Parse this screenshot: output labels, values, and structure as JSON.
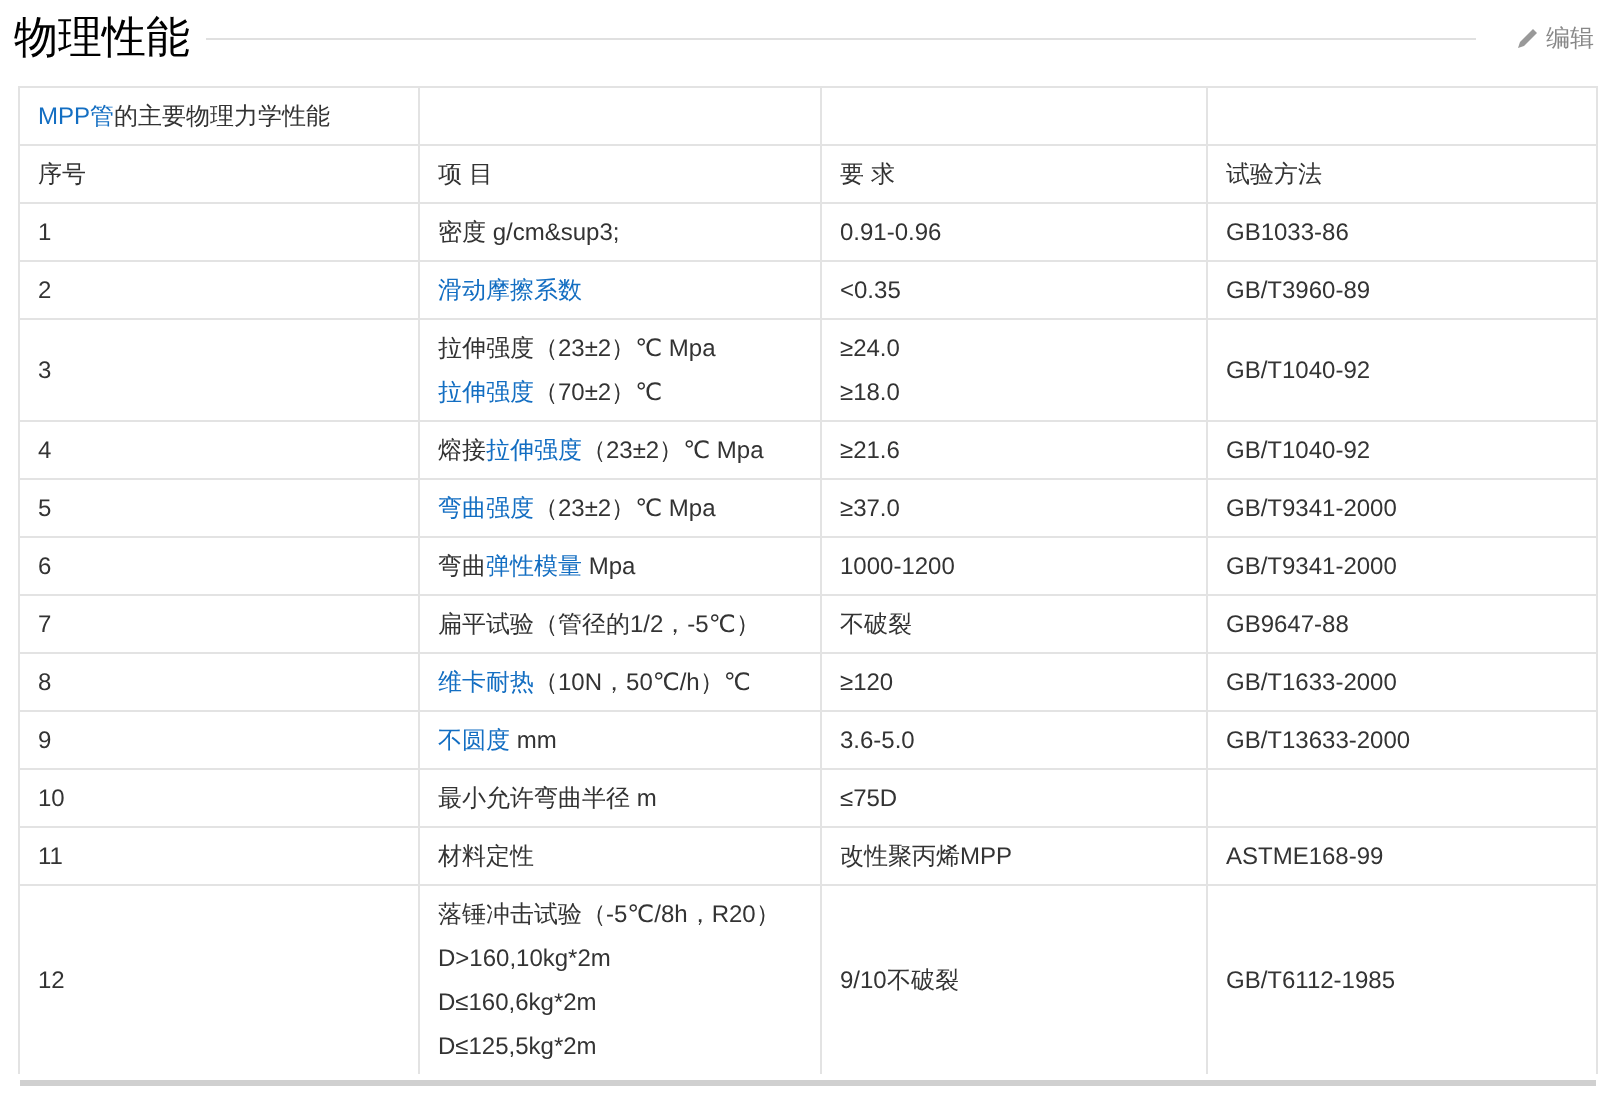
{
  "section": {
    "title": "物理性能",
    "edit_label": "编辑"
  },
  "table": {
    "rows": [
      {
        "cells": [
          [
            [
              {
                "text": "MPP管",
                "link": true
              },
              {
                "text": "的主要物理力学性能",
                "link": false
              }
            ]
          ],
          [],
          [],
          []
        ]
      },
      {
        "cells": [
          [
            [
              {
                "text": "序号",
                "link": false
              }
            ]
          ],
          [
            [
              {
                "text": "项 目",
                "link": false
              }
            ]
          ],
          [
            [
              {
                "text": "要 求",
                "link": false
              }
            ]
          ],
          [
            [
              {
                "text": "试验方法",
                "link": false
              }
            ]
          ]
        ]
      },
      {
        "cells": [
          [
            [
              {
                "text": "1",
                "link": false
              }
            ]
          ],
          [
            [
              {
                "text": "密度 g/cm&sup3;",
                "link": false
              }
            ]
          ],
          [
            [
              {
                "text": "0.91-0.96",
                "link": false
              }
            ]
          ],
          [
            [
              {
                "text": "GB1033-86",
                "link": false
              }
            ]
          ]
        ]
      },
      {
        "cells": [
          [
            [
              {
                "text": "2",
                "link": false
              }
            ]
          ],
          [
            [
              {
                "text": "滑动摩擦系数",
                "link": true
              }
            ]
          ],
          [
            [
              {
                "text": "<0.35",
                "link": false
              }
            ]
          ],
          [
            [
              {
                "text": "GB/T3960-89",
                "link": false
              }
            ]
          ]
        ]
      },
      {
        "cells": [
          [
            [
              {
                "text": "3",
                "link": false
              }
            ]
          ],
          [
            [
              {
                "text": "拉伸强度（23±2）℃ Mpa",
                "link": false
              }
            ],
            [
              {
                "text": "拉伸强度",
                "link": true
              },
              {
                "text": "（70±2）℃",
                "link": false
              }
            ]
          ],
          [
            [
              {
                "text": "≥24.0",
                "link": false
              }
            ],
            [
              {
                "text": "≥18.0",
                "link": false
              }
            ]
          ],
          [
            [
              {
                "text": "GB/T1040-92",
                "link": false
              }
            ]
          ]
        ]
      },
      {
        "cells": [
          [
            [
              {
                "text": "4",
                "link": false
              }
            ]
          ],
          [
            [
              {
                "text": "熔接",
                "link": false
              },
              {
                "text": "拉伸强度",
                "link": true
              },
              {
                "text": "（23±2）℃ Mpa",
                "link": false
              }
            ]
          ],
          [
            [
              {
                "text": "≥21.6",
                "link": false
              }
            ]
          ],
          [
            [
              {
                "text": "GB/T1040-92",
                "link": false
              }
            ]
          ]
        ]
      },
      {
        "cells": [
          [
            [
              {
                "text": "5",
                "link": false
              }
            ]
          ],
          [
            [
              {
                "text": "弯曲强度",
                "link": true
              },
              {
                "text": "（23±2）℃ Mpa",
                "link": false
              }
            ]
          ],
          [
            [
              {
                "text": "≥37.0",
                "link": false
              }
            ]
          ],
          [
            [
              {
                "text": "GB/T9341-2000",
                "link": false
              }
            ]
          ]
        ]
      },
      {
        "cells": [
          [
            [
              {
                "text": "6",
                "link": false
              }
            ]
          ],
          [
            [
              {
                "text": "弯曲",
                "link": false
              },
              {
                "text": "弹性模量",
                "link": true
              },
              {
                "text": " Mpa",
                "link": false
              }
            ]
          ],
          [
            [
              {
                "text": "1000-1200",
                "link": false
              }
            ]
          ],
          [
            [
              {
                "text": "GB/T9341-2000",
                "link": false
              }
            ]
          ]
        ]
      },
      {
        "cells": [
          [
            [
              {
                "text": "7",
                "link": false
              }
            ]
          ],
          [
            [
              {
                "text": "扁平试验（管径的1/2，-5℃）",
                "link": false
              }
            ]
          ],
          [
            [
              {
                "text": "不破裂",
                "link": false
              }
            ]
          ],
          [
            [
              {
                "text": "GB9647-88",
                "link": false
              }
            ]
          ]
        ]
      },
      {
        "cells": [
          [
            [
              {
                "text": "8",
                "link": false
              }
            ]
          ],
          [
            [
              {
                "text": "维卡耐热",
                "link": true
              },
              {
                "text": "（10N，50℃/h）℃",
                "link": false
              }
            ]
          ],
          [
            [
              {
                "text": "≥120",
                "link": false
              }
            ]
          ],
          [
            [
              {
                "text": "GB/T1633-2000",
                "link": false
              }
            ]
          ]
        ]
      },
      {
        "cells": [
          [
            [
              {
                "text": "9",
                "link": false
              }
            ]
          ],
          [
            [
              {
                "text": "不圆度",
                "link": true
              },
              {
                "text": " mm",
                "link": false
              }
            ]
          ],
          [
            [
              {
                "text": "3.6-5.0",
                "link": false
              }
            ]
          ],
          [
            [
              {
                "text": "GB/T13633-2000",
                "link": false
              }
            ]
          ]
        ]
      },
      {
        "cells": [
          [
            [
              {
                "text": "10",
                "link": false
              }
            ]
          ],
          [
            [
              {
                "text": "最小允许弯曲半径 m",
                "link": false
              }
            ]
          ],
          [
            [
              {
                "text": "≤75D",
                "link": false
              }
            ]
          ],
          []
        ]
      },
      {
        "cells": [
          [
            [
              {
                "text": "11",
                "link": false
              }
            ]
          ],
          [
            [
              {
                "text": "材料定性",
                "link": false
              }
            ]
          ],
          [
            [
              {
                "text": "改性聚丙烯MPP",
                "link": false
              }
            ]
          ],
          [
            [
              {
                "text": "ASTME168-99",
                "link": false
              }
            ]
          ]
        ]
      },
      {
        "cells": [
          [
            [
              {
                "text": "12",
                "link": false
              }
            ]
          ],
          [
            [
              {
                "text": "落锤冲击试验（-5℃/8h，R20）",
                "link": false
              }
            ],
            [
              {
                "text": "D>160,10kg*2m",
                "link": false
              }
            ],
            [
              {
                "text": "D≤160,6kg*2m",
                "link": false
              }
            ],
            [
              {
                "text": "D≤125,5kg*2m",
                "link": false
              }
            ]
          ],
          [
            [
              {
                "text": "9/10不破裂",
                "link": false
              }
            ]
          ],
          [
            [
              {
                "text": "GB/T6112-1985",
                "link": false
              }
            ]
          ]
        ]
      }
    ]
  }
}
